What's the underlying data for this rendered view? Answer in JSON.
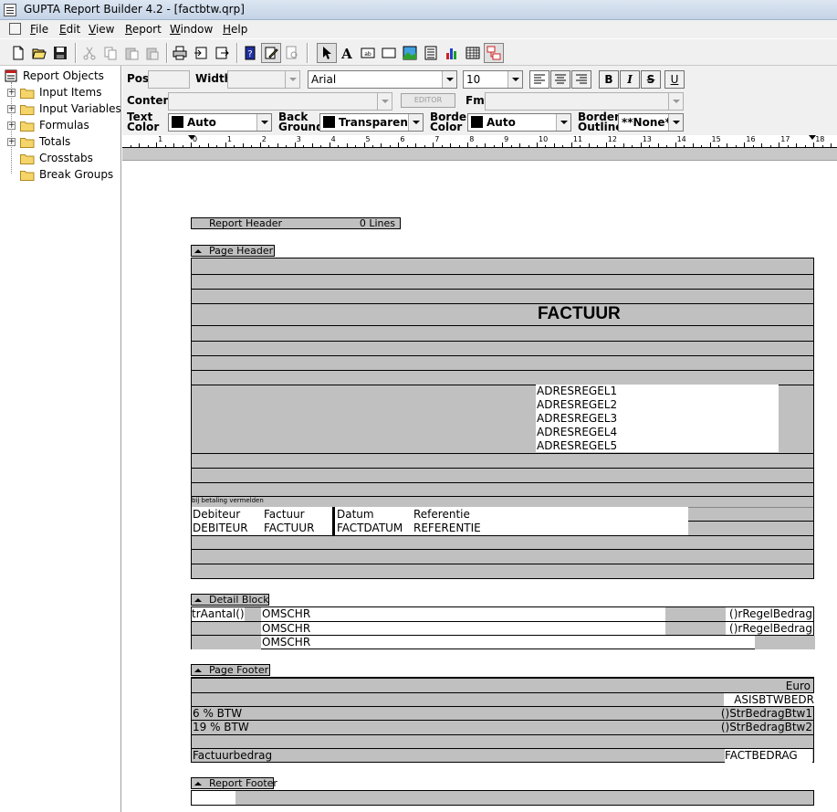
{
  "window": {
    "title": "GUPTA Report Builder 4.2 - [factbtw.qrp]"
  },
  "menu": [
    {
      "label": "File",
      "key": "F",
      "rest": "ile"
    },
    {
      "label": "Edit",
      "key": "E",
      "rest": "dit"
    },
    {
      "label": "View",
      "key": "V",
      "rest": "iew"
    },
    {
      "label": "Report",
      "key": "R",
      "rest": "eport"
    },
    {
      "label": "Window",
      "key": "W",
      "rest": "indow"
    },
    {
      "label": "Help",
      "key": "H",
      "rest": "elp"
    }
  ],
  "tree": {
    "root": "Report Objects",
    "items": [
      "Input Items",
      "Input Variables",
      "Formulas",
      "Totals",
      "Crosstabs",
      "Break Groups"
    ]
  },
  "props": {
    "pos_label": "Pos",
    "width_label": "Width",
    "font": "Arial",
    "size": "10",
    "content_label": "Content",
    "editor_label": "EDITOR",
    "fmt_label": "Fmt",
    "text_color_label": [
      "Text",
      "Color"
    ],
    "text_color": "Auto",
    "background_label": [
      "Back",
      "Ground"
    ],
    "background": "Transparent",
    "border_color_label": [
      "Border",
      "Color"
    ],
    "border_color": "Auto",
    "border_outline_label": [
      "Border",
      "Outline"
    ],
    "border_outline": "**None**",
    "bold": "B",
    "italic": "I",
    "strike": "S",
    "underline": "U"
  },
  "ruler": {
    "marks": [
      "1",
      "0",
      "1",
      "2",
      "3",
      "4",
      "5",
      "6",
      "7",
      "8",
      "9",
      "10",
      "11",
      "12",
      "13",
      "14",
      "15",
      "16",
      "17",
      "18"
    ]
  },
  "report": {
    "report_header": {
      "label": "Report Header",
      "lines": "0 Lines"
    },
    "page_header": {
      "label": "Page Header",
      "title": "FACTUUR",
      "address": [
        "ADRESREGEL1",
        "ADRESREGEL2",
        "ADRESREGEL3",
        "ADRESREGEL4",
        "ADRESREGEL5"
      ],
      "note": "bij betaling vermelden",
      "columns": [
        "Debiteur",
        "Factuur",
        "Datum",
        "Referentie"
      ],
      "values": [
        "DEBITEUR",
        "FACTUUR",
        "FACTDATUM",
        "REFERENTIE"
      ]
    },
    "detail_block": {
      "label": "Detail Block",
      "rows": [
        {
          "qty": "trAantal()",
          "desc": "OMSCHR",
          "amount": "rRegelBedrag()"
        },
        {
          "qty": "",
          "desc": "OMSCHR",
          "amount": "rRegelBedrag()"
        },
        {
          "qty": "",
          "desc": "OMSCHR",
          "amount": ""
        }
      ]
    },
    "page_footer": {
      "label": "Page Footer",
      "currency": "Euro",
      "basis": "ASISBTWBEDR",
      "btw1_label": "6 % BTW",
      "btw1_value": "StrBedragBtw1()",
      "btw2_label": "19 % BTW",
      "btw2_value": "StrBedragBtw2()",
      "total_label": "Factuurbedrag",
      "total_value": "FACTBEDRAG"
    },
    "report_footer": {
      "label": "Report Footer"
    }
  }
}
